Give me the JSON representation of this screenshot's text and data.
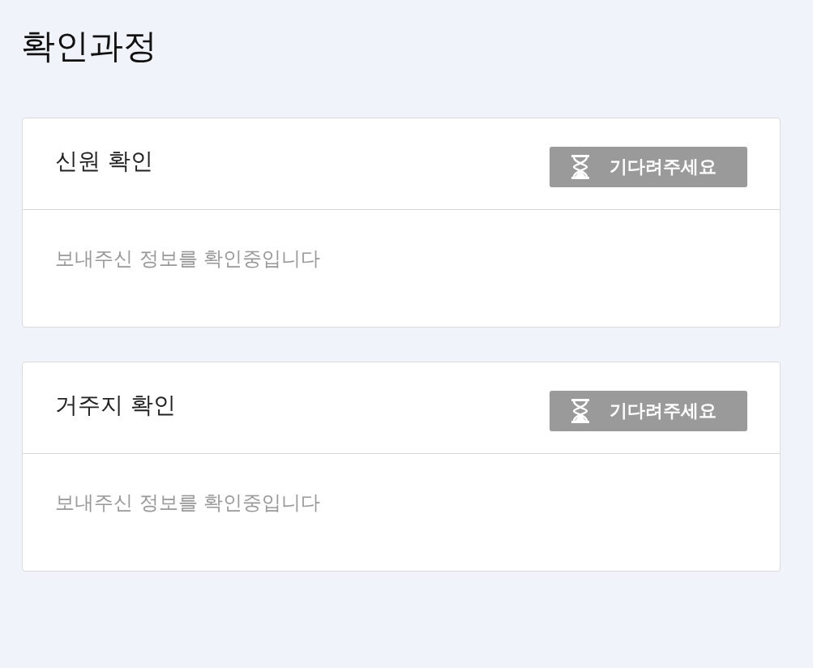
{
  "title": "확인과정",
  "steps": [
    {
      "title": "신원 확인",
      "status": {
        "kind": "waiting",
        "label": "기다려주세요"
      },
      "message": "보내주신 정보를 확인중입니다"
    },
    {
      "title": "거주지 확인",
      "status": {
        "kind": "waiting",
        "label": "기다려주세요"
      },
      "message": "보내주신 정보를 확인중입니다"
    }
  ]
}
